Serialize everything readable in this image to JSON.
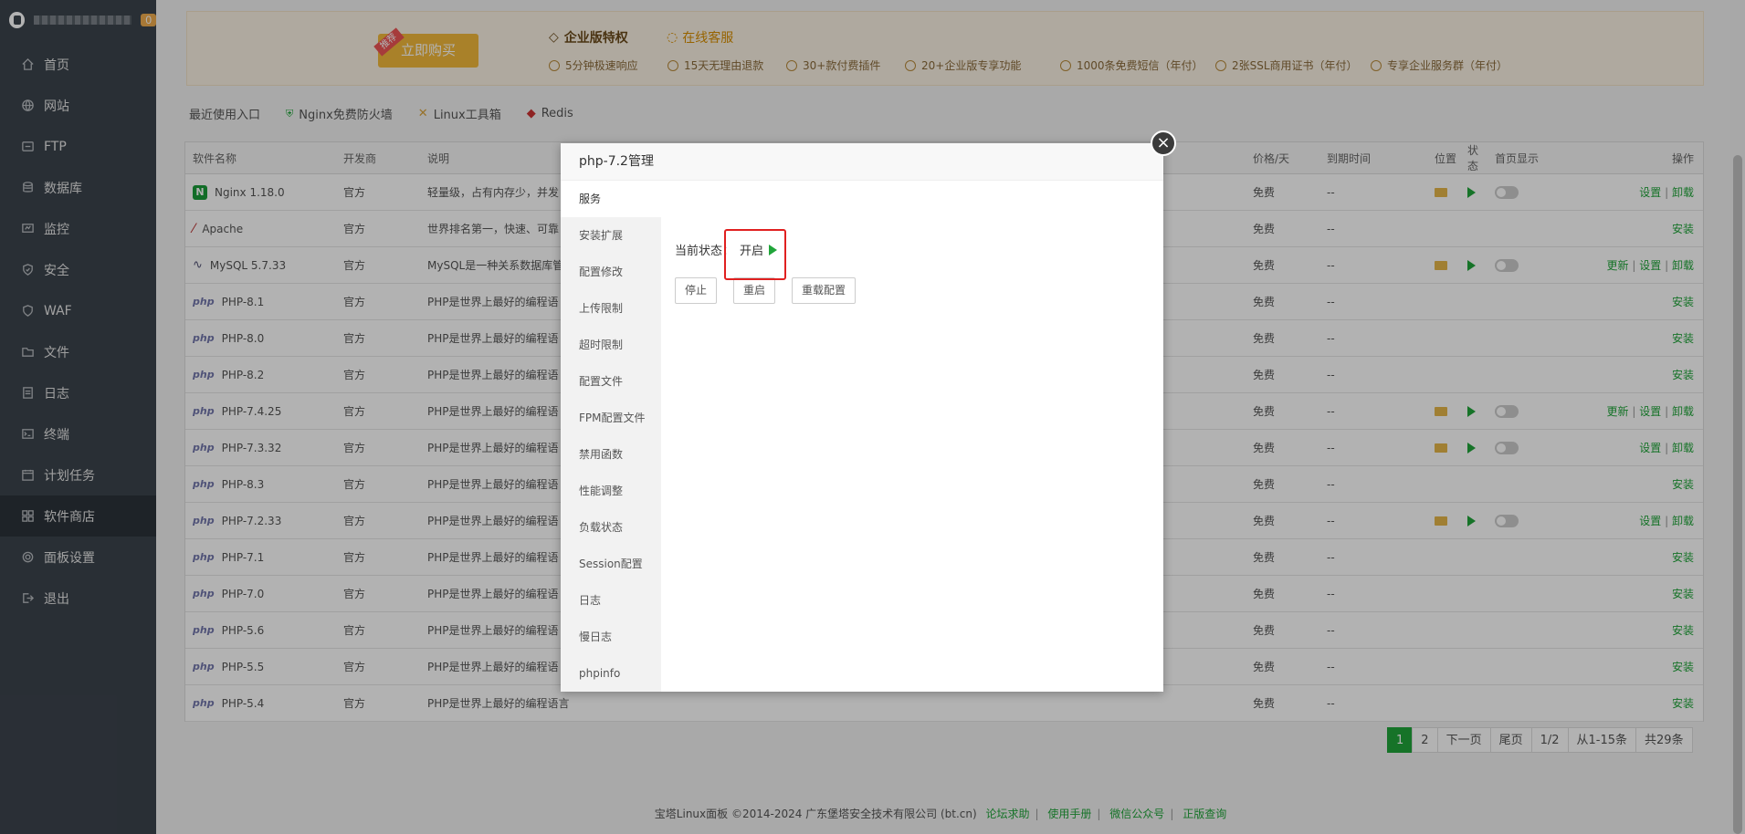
{
  "sidebar": {
    "badge": "0",
    "items": [
      {
        "label": "首页",
        "icon": "home-icon"
      },
      {
        "label": "网站",
        "icon": "globe-icon"
      },
      {
        "label": "FTP",
        "icon": "ftp-icon"
      },
      {
        "label": "数据库",
        "icon": "database-icon"
      },
      {
        "label": "监控",
        "icon": "monitor-icon"
      },
      {
        "label": "安全",
        "icon": "shield-icon"
      },
      {
        "label": "WAF",
        "icon": "waf-icon"
      },
      {
        "label": "文件",
        "icon": "folder-icon"
      },
      {
        "label": "日志",
        "icon": "log-icon"
      },
      {
        "label": "终端",
        "icon": "terminal-icon"
      },
      {
        "label": "计划任务",
        "icon": "calendar-icon"
      },
      {
        "label": "软件商店",
        "icon": "grid-icon"
      },
      {
        "label": "面板设置",
        "icon": "gear-icon"
      },
      {
        "label": "退出",
        "icon": "logout-icon"
      }
    ],
    "active_index": 11
  },
  "banner": {
    "buy_tag": "推荐",
    "buy_label": "立即购买",
    "pro_title": "企业版特权",
    "service": "在线客服",
    "features": [
      "5分钟极速响应",
      "15天无理由退款",
      "30+款付费插件",
      "20+企业版专享功能",
      "1000条免费短信（年付）",
      "2张SSL商用证书（年付）",
      "专享企业服务群（年付）"
    ]
  },
  "quick": {
    "label": "最近使用入口",
    "items": [
      "Nginx免费防火墙",
      "Linux工具箱",
      "Redis"
    ]
  },
  "table": {
    "headers": [
      "软件名称",
      "开发商",
      "说明",
      "价格/天",
      "到期时间",
      "位置",
      "状态",
      "首页显示",
      "操作"
    ],
    "rows": [
      {
        "name": "Nginx 1.18.0",
        "dev": "官方",
        "desc": "轻量级，占有内存少，并发",
        "price": "免费",
        "expire": "--",
        "installed": true,
        "ops": "设置 | 卸载",
        "icon": "nginx-icon"
      },
      {
        "name": "Apache",
        "dev": "官方",
        "desc": "世界排名第一，快速、可靠",
        "price": "免费",
        "expire": "--",
        "installed": false,
        "ops": "安装",
        "icon": "apache-icon"
      },
      {
        "name": "MySQL 5.7.33",
        "dev": "官方",
        "desc": "MySQL是一种关系数据库管",
        "price": "免费",
        "expire": "--",
        "installed": true,
        "ops": "更新 | 设置 | 卸载",
        "icon": "mysql-icon"
      },
      {
        "name": "PHP-8.1",
        "dev": "官方",
        "desc": "PHP是世界上最好的编程语",
        "price": "免费",
        "expire": "--",
        "installed": false,
        "ops": "安装",
        "icon": "php-icon"
      },
      {
        "name": "PHP-8.0",
        "dev": "官方",
        "desc": "PHP是世界上最好的编程语",
        "price": "免费",
        "expire": "--",
        "installed": false,
        "ops": "安装",
        "icon": "php-icon"
      },
      {
        "name": "PHP-8.2",
        "dev": "官方",
        "desc": "PHP是世界上最好的编程语",
        "price": "免费",
        "expire": "--",
        "installed": false,
        "ops": "安装",
        "icon": "php-icon"
      },
      {
        "name": "PHP-7.4.25",
        "dev": "官方",
        "desc": "PHP是世界上最好的编程语",
        "price": "免费",
        "expire": "--",
        "installed": true,
        "ops": "更新 | 设置 | 卸载",
        "icon": "php-icon"
      },
      {
        "name": "PHP-7.3.32",
        "dev": "官方",
        "desc": "PHP是世界上最好的编程语",
        "price": "免费",
        "expire": "--",
        "installed": true,
        "ops": "设置 | 卸载",
        "icon": "php-icon"
      },
      {
        "name": "PHP-8.3",
        "dev": "官方",
        "desc": "PHP是世界上最好的编程语",
        "price": "免费",
        "expire": "--",
        "installed": false,
        "ops": "安装",
        "icon": "php-icon"
      },
      {
        "name": "PHP-7.2.33",
        "dev": "官方",
        "desc": "PHP是世界上最好的编程语",
        "price": "免费",
        "expire": "--",
        "installed": true,
        "ops": "设置 | 卸载",
        "icon": "php-icon"
      },
      {
        "name": "PHP-7.1",
        "dev": "官方",
        "desc": "PHP是世界上最好的编程语",
        "price": "免费",
        "expire": "--",
        "installed": false,
        "ops": "安装",
        "icon": "php-icon"
      },
      {
        "name": "PHP-7.0",
        "dev": "官方",
        "desc": "PHP是世界上最好的编程语",
        "price": "免费",
        "expire": "--",
        "installed": false,
        "ops": "安装",
        "icon": "php-icon"
      },
      {
        "name": "PHP-5.6",
        "dev": "官方",
        "desc": "PHP是世界上最好的编程语",
        "price": "免费",
        "expire": "--",
        "installed": false,
        "ops": "安装",
        "icon": "php-icon"
      },
      {
        "name": "PHP-5.5",
        "dev": "官方",
        "desc": "PHP是世界上最好的编程语",
        "price": "免费",
        "expire": "--",
        "installed": false,
        "ops": "安装",
        "icon": "php-icon"
      },
      {
        "name": "PHP-5.4",
        "dev": "官方",
        "desc": "PHP是世界上最好的编程语言",
        "price": "免费",
        "expire": "--",
        "installed": false,
        "ops": "安装",
        "icon": "php-icon"
      }
    ]
  },
  "pager": {
    "pages": [
      "1",
      "2"
    ],
    "next": "下一页",
    "last": "尾页",
    "page_of": "1/2",
    "range": "从1-15条",
    "total": "共29条"
  },
  "footer": {
    "copyright": "宝塔Linux面板 ©2014-2024 广东堡塔安全技术有限公司 (bt.cn)",
    "links": [
      "论坛求助",
      "使用手册",
      "微信公众号",
      "正版查询"
    ]
  },
  "modal": {
    "title": "php-7.2管理",
    "menu": [
      "服务",
      "安装扩展",
      "配置修改",
      "上传限制",
      "超时限制",
      "配置文件",
      "FPM配置文件",
      "禁用函数",
      "性能调整",
      "负载状态",
      "Session配置",
      "日志",
      "慢日志",
      "phpinfo"
    ],
    "active_menu": 0,
    "status_label": "当前状态：",
    "status_value": "开启",
    "buttons": [
      "停止",
      "重启",
      "重载配置"
    ]
  },
  "colors": {
    "accent": "#20a53a",
    "sidebar": "#3c444d",
    "highlight": "#e02020",
    "buy": "#f3b93c"
  }
}
